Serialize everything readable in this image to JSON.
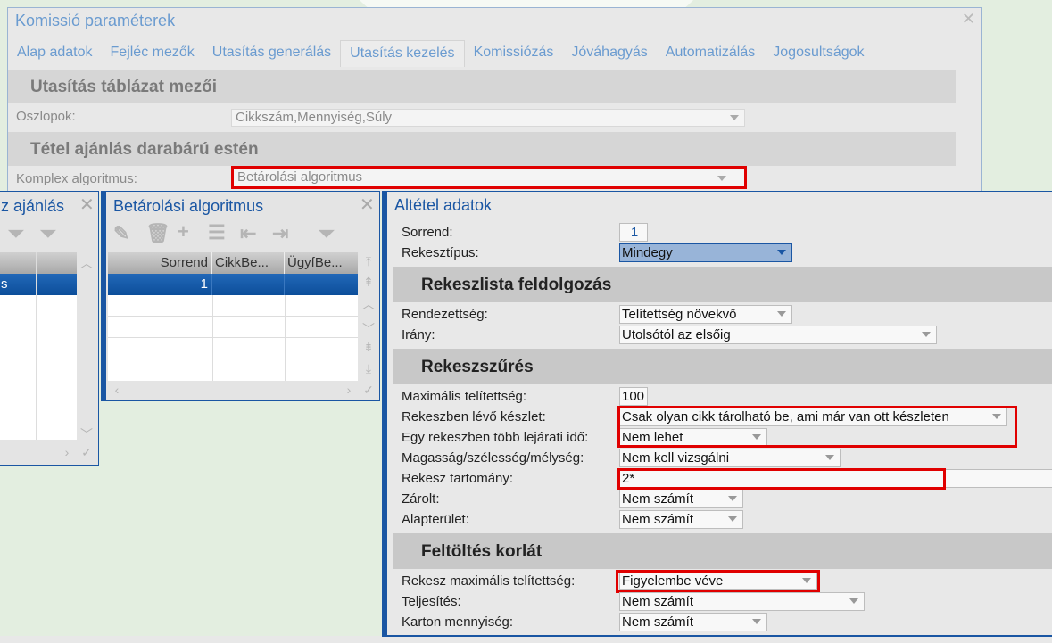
{
  "main": {
    "title": "Komissió paraméterek",
    "tabs": [
      "Alap adatok",
      "Fejléc mezők",
      "Utasítás generálás",
      "Utasítás kezelés",
      "Komissiózás",
      "Jóváhagyás",
      "Automatizálás",
      "Jogosultságok"
    ],
    "active_tab": "Utasítás kezelés",
    "section1": "Utasítás táblázat mezői",
    "oszlopok_label": "Oszlopok:",
    "oszlopok_value": "Cikkszám,Mennyiség,Súly",
    "section2": "Tétel ajánlás darabárú estén",
    "komplex_label": "Komplex algoritmus:",
    "komplex_value": "Betárolási algoritmus"
  },
  "left_panel": {
    "title": "z ajánlás",
    "selected_cell": "s"
  },
  "mid_panel": {
    "title": "Betárolási algoritmus",
    "columns": [
      "Sorrend",
      "CikkBe...",
      "ÜgyfBe..."
    ],
    "rows": [
      [
        "1",
        "",
        ""
      ]
    ]
  },
  "right_panel": {
    "title": "Altétel adatok",
    "sorrend_label": "Sorrend:",
    "sorrend": "1",
    "rekesztipus_label": "Rekesztípus:",
    "rekesztipus": "Mindegy",
    "sec1": "Rekeszlista feldolgozás",
    "rendezettseg_label": "Rendezettség:",
    "rendezettseg": "Telítettség növekvő",
    "irany_label": "Irány:",
    "irany": "Utolsótól az elsőig",
    "sec2": "Rekeszszűrés",
    "max_label": "Maximális telítettség:",
    "max": "100",
    "keszlet_label": "Rekeszben lévő készlet:",
    "keszlet": "Csak olyan cikk tárolható be, ami már van ott készleten",
    "lejarat_label": "Egy rekeszben több lejárati idő:",
    "lejarat": "Nem lehet",
    "meret_label": "Magasság/szélesség/mélység:",
    "meret": "Nem kell vizsgálni",
    "tartomany_label": "Rekesz tartomány:",
    "tartomany": "2*",
    "zarolt_label": "Zárolt:",
    "zarolt": "Nem számít",
    "alap_label": "Alapterület:",
    "alap": "Nem számít",
    "sec3": "Feltöltés korlát",
    "rmax_label": "Rekesz maximális telítettség:",
    "rmax": "Figyelembe véve",
    "telj_label": "Teljesítés:",
    "telj": "Nem számít",
    "karton_label": "Karton mennyiség:",
    "karton": "Nem számít"
  },
  "colors": {
    "accent": "#1a56a3",
    "highlight": "#e00000",
    "selection": "#0c4e9a"
  }
}
